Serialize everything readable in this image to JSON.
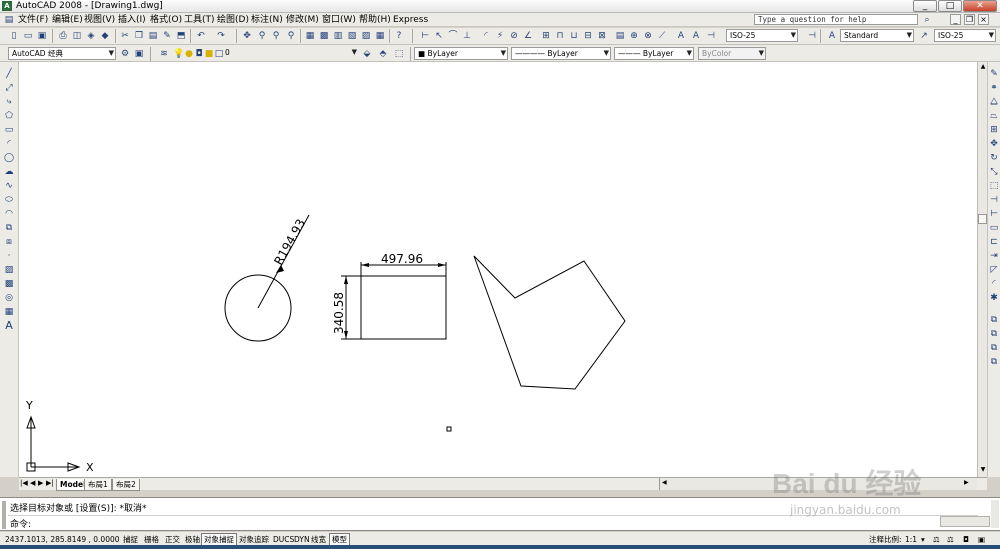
{
  "window": {
    "title": "AutoCAD 2008 - [Drawing1.dwg]",
    "app_icon": "A",
    "min": "_",
    "max": "□",
    "close": "✕"
  },
  "menu": [
    "文件(F)",
    "编辑(E)",
    "视图(V)",
    "插入(I)",
    "格式(O)",
    "工具(T)",
    "绘图(D)",
    "标注(N)",
    "修改(M)",
    "窗口(W)",
    "帮助(H)",
    "Express"
  ],
  "help_search": {
    "placeholder": "Type a question for help"
  },
  "toolbar_styles": {
    "dim_style": "ISO-25",
    "text_style": "Standard",
    "mleader_style": "ISO-25"
  },
  "workspace": "AutoCAD 经典",
  "layer": "0",
  "properties": {
    "color": "ByLayer",
    "linetype": "ByLayer",
    "lineweight": "ByLayer",
    "plotstyle": "ByColor"
  },
  "drawing": {
    "radius_dim": "R194.93",
    "width_dim": "497.96",
    "height_dim": "340.58"
  },
  "ucs": {
    "x": "X",
    "y": "Y"
  },
  "layout_tabs": [
    "Model",
    "布局1",
    "布局2"
  ],
  "command": {
    "history": "选择目标对象或 [设置(S)]: *取消*",
    "prompt": "命令:"
  },
  "status": {
    "coords": "2437.1013, 285.8149 , 0.0000",
    "toggles": [
      "捕捉",
      "栅格",
      "正交",
      "极轴",
      "对象捕捉",
      "对象追踪",
      "DUCS",
      "DYN",
      "线宽",
      "模型"
    ],
    "annotation_scale_label": "注释比例:",
    "annotation_scale": "1:1"
  },
  "watermark": {
    "brand": "Bai du 经验",
    "url": "jingyan.baidu.com"
  },
  "colors": {
    "ui_bg": "#ecebe6",
    "canvas": "#ffffff",
    "ink": "#000000",
    "accent": "#24427a"
  }
}
